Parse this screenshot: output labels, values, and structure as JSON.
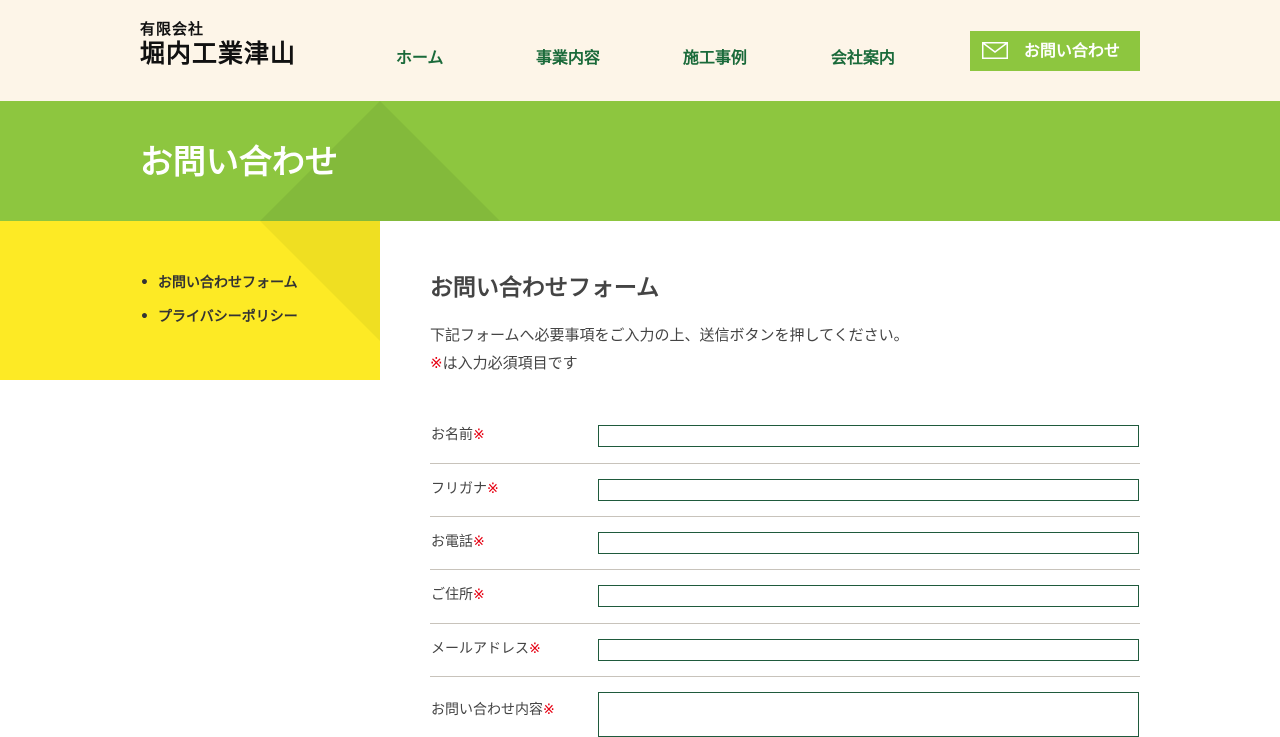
{
  "header": {
    "logo_small": "有限会社",
    "logo_main": "堀内工業津山",
    "nav": [
      "ホーム",
      "事業内容",
      "施工事例",
      "会社案内"
    ],
    "contact_button": "お問い合わせ",
    "contact_icon": "mail-icon"
  },
  "banner": {
    "title": "お問い合わせ"
  },
  "sidebar": {
    "items": [
      "お問い合わせフォーム",
      "プライバシーポリシー"
    ]
  },
  "main": {
    "heading": "お問い合わせフォーム",
    "intro_line1": "下記フォームへ必要事項をご入力の上、送信ボタンを押してください。",
    "required_mark": "※",
    "intro_line2_rest": "は入力必須項目です",
    "fields": [
      {
        "label": "お名前",
        "value": ""
      },
      {
        "label": "フリガナ",
        "value": ""
      },
      {
        "label": "お電話",
        "value": ""
      },
      {
        "label": "ご住所",
        "value": ""
      },
      {
        "label": "メールアドレス",
        "value": ""
      },
      {
        "label": "お問い合わせ内容",
        "value": ""
      }
    ]
  },
  "colors": {
    "header_bg": "#fdf5e8",
    "accent_green": "#8dc63f",
    "nav_text": "#1a6a3a",
    "sidebar_yellow": "#fdea25",
    "required_red": "#e60012",
    "input_border": "#1f5a3c"
  }
}
